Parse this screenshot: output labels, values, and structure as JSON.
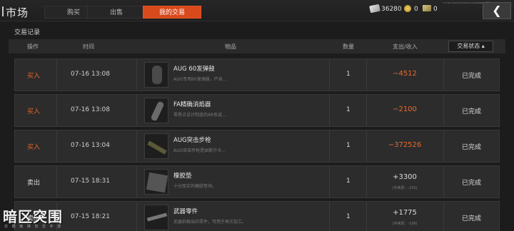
{
  "header": {
    "title": "市场",
    "tabs": [
      "购买",
      "出售",
      "我的交易"
    ],
    "currency_cash": "36280",
    "currency_gold": "0",
    "currency_bill": "0",
    "version": "1.0.718.79021|0710|3221|1236988853|国区",
    "back_icon": "chevron-left-icon"
  },
  "section_title": "交易记录",
  "columns": {
    "op": "操作",
    "time": "时间",
    "item": "物品",
    "qty": "数量",
    "amount": "支出/收入",
    "status": "交易状态"
  },
  "status_sort_icon": "chevron-up-icon",
  "rows": [
    {
      "type": "买入",
      "time": "07-16 13:08",
      "name": "AUG 60发弹鼓",
      "desc": "AUG专用60发弹鼓，产自...",
      "qty": "1",
      "amount": "−4512",
      "fee": "",
      "status": "已完成",
      "kind": "buy",
      "icon": "magazine-icon"
    },
    {
      "type": "买入",
      "time": "07-16 13:08",
      "name": "FA精确消焰器",
      "desc": "零界点设计制造的AR系武...",
      "qty": "1",
      "amount": "−2100",
      "fee": "",
      "status": "已完成",
      "kind": "buy",
      "icon": "flash-hider-icon"
    },
    {
      "type": "买入",
      "time": "07-16 13:04",
      "name": "AUG突击步枪",
      "desc": "AUG突击步枪是由斯尔卡...",
      "qty": "1",
      "amount": "−372526",
      "fee": "",
      "status": "已完成",
      "kind": "buy",
      "icon": "rifle-icon"
    },
    {
      "type": "卖出",
      "time": "07-15 18:31",
      "name": "橡胶垫",
      "desc": "十分厚实的橡胶垫块。",
      "qty": "1",
      "amount": "+3300",
      "fee": "(手续费：-230)",
      "status": "已完成",
      "kind": "sell",
      "icon": "rubber-pad-icon"
    },
    {
      "type": "卖出",
      "time": "07-15 18:21",
      "name": "武器零件",
      "desc": "武器拆解出的零件，可用于再次加工。",
      "qty": "1",
      "amount": "+1775",
      "fee": "(手续费：-196)",
      "status": "已完成",
      "kind": "sell",
      "icon": "weapon-parts-icon"
    }
  ],
  "logo": {
    "text": "暗区突围",
    "sub": "日 晒 雨 淋 勿 忘 手 游"
  },
  "colors": {
    "accent": "#d8491c",
    "negative": "#ea6a2c"
  }
}
